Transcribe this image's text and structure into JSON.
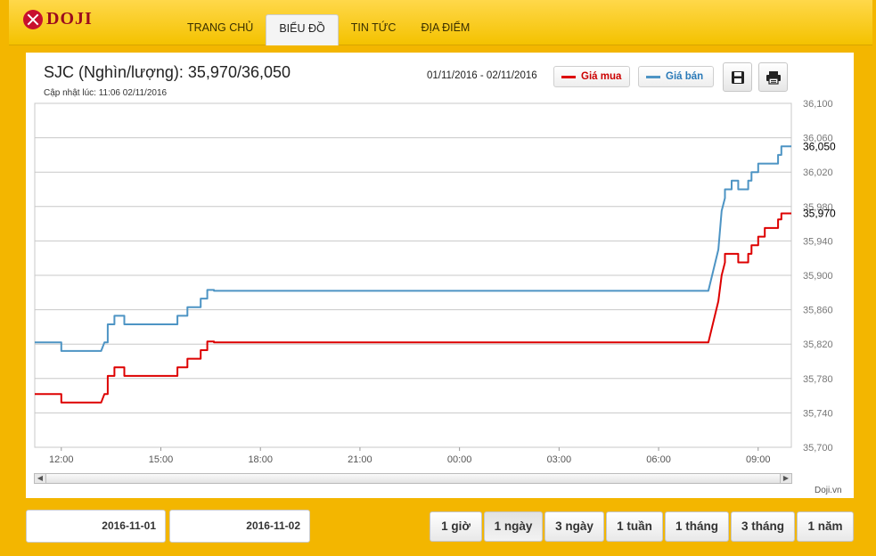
{
  "brand": {
    "name": "DOJI"
  },
  "nav": [
    {
      "label": "TRANG CHỦ",
      "active": false
    },
    {
      "label": "BIỂU ĐỒ",
      "active": true
    },
    {
      "label": "TIN TỨC",
      "active": false
    },
    {
      "label": "ĐỊA ĐIỂM",
      "active": false
    }
  ],
  "panel": {
    "title": "SJC (Nghìn/lượng): 35,970/36,050",
    "updated": "Cập nhật lúc: 11:06 02/11/2016",
    "date_range": "01/11/2016 - 02/11/2016",
    "legend_buy": "Giá mua",
    "legend_sell": "Giá bán",
    "save_icon": "save-icon",
    "print_icon": "print-icon",
    "credit": "Doji.vn"
  },
  "dates": {
    "from": "2016-11-01",
    "to": "2016-11-02"
  },
  "periods": [
    {
      "label": "1 giờ",
      "active": false
    },
    {
      "label": "1 ngày",
      "active": true
    },
    {
      "label": "3 ngày",
      "active": false
    },
    {
      "label": "1 tuần",
      "active": false
    },
    {
      "label": "1 tháng",
      "active": false
    },
    {
      "label": "3 tháng",
      "active": false
    },
    {
      "label": "1 năm",
      "active": false
    }
  ],
  "colors": {
    "buy": "#dd0000",
    "sell": "#4d94c4",
    "grid": "#c8c8c8"
  },
  "chart_data": {
    "type": "line",
    "x_ticks": [
      "12:00",
      "15:00",
      "18:00",
      "21:00",
      "00:00",
      "03:00",
      "06:00",
      "09:00"
    ],
    "y_ticks": [
      35700,
      35740,
      35780,
      35820,
      35860,
      35900,
      35940,
      35980,
      36020,
      36060,
      36100
    ],
    "ylim": [
      35700,
      36100
    ],
    "xlim": [
      -0.8,
      22.0
    ],
    "grid": true,
    "last_labels": {
      "buy": "35,970",
      "sell": "36,050"
    },
    "series": [
      {
        "name": "Giá bán",
        "color": "#4d94c4",
        "x": [
          -0.8,
          0.0,
          0.0,
          1.2,
          1.3,
          1.4,
          1.4,
          1.6,
          1.6,
          1.9,
          1.9,
          2.2,
          2.2,
          3.5,
          3.5,
          3.8,
          3.8,
          4.2,
          4.2,
          4.4,
          4.4,
          4.6,
          4.6,
          19.5,
          19.8,
          19.9,
          20.0,
          20.0,
          20.2,
          20.2,
          20.4,
          20.4,
          20.7,
          20.7,
          20.8,
          20.8,
          21.0,
          21.0,
          21.2,
          21.2,
          21.4,
          21.4,
          21.6,
          21.6,
          21.7,
          21.7,
          21.8,
          21.8,
          22.0
        ],
        "y": [
          35822,
          35822,
          35812,
          35812,
          35822,
          35822,
          35843,
          35843,
          35853,
          35853,
          35843,
          35843,
          35843,
          35843,
          35853,
          35853,
          35863,
          35863,
          35873,
          35873,
          35883,
          35883,
          35882,
          35882,
          35930,
          35975,
          35990,
          36000,
          36000,
          36010,
          36010,
          36000,
          36000,
          36010,
          36010,
          36020,
          36020,
          36030,
          36030,
          36030,
          36030,
          36030,
          36030,
          36040,
          36040,
          36050,
          36050,
          36050,
          36050
        ]
      },
      {
        "name": "Giá mua",
        "color": "#dd0000",
        "x": [
          -0.8,
          0.0,
          0.0,
          1.2,
          1.3,
          1.4,
          1.4,
          1.6,
          1.6,
          1.9,
          1.9,
          2.2,
          2.2,
          3.5,
          3.5,
          3.8,
          3.8,
          4.2,
          4.2,
          4.4,
          4.4,
          4.6,
          4.6,
          19.5,
          19.8,
          19.9,
          20.0,
          20.0,
          20.2,
          20.2,
          20.4,
          20.4,
          20.7,
          20.7,
          20.8,
          20.8,
          21.0,
          21.0,
          21.2,
          21.2,
          21.6,
          21.6,
          21.7,
          21.7,
          22.0
        ],
        "y": [
          35762,
          35762,
          35752,
          35752,
          35762,
          35762,
          35783,
          35783,
          35793,
          35793,
          35783,
          35783,
          35783,
          35783,
          35793,
          35793,
          35803,
          35803,
          35813,
          35813,
          35823,
          35823,
          35822,
          35822,
          35870,
          35900,
          35915,
          35925,
          35925,
          35925,
          35925,
          35915,
          35915,
          35925,
          35925,
          35935,
          35935,
          35945,
          35945,
          35955,
          35955,
          35965,
          35965,
          35972,
          35972
        ]
      }
    ]
  }
}
